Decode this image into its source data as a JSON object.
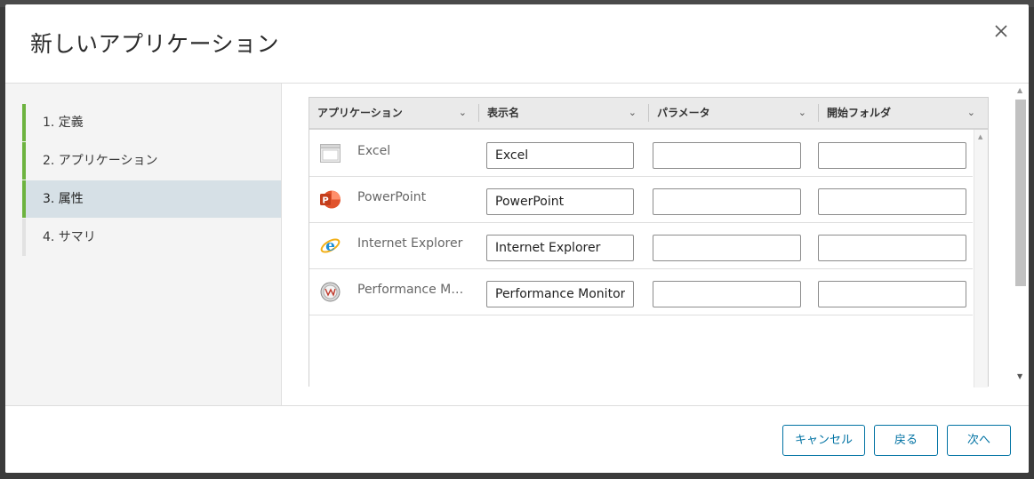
{
  "dialog": {
    "title": "新しいアプリケーション",
    "close_icon": "close-icon"
  },
  "steps": [
    {
      "label": "1. 定義",
      "state": "done"
    },
    {
      "label": "2. アプリケーション",
      "state": "done"
    },
    {
      "label": "3. 属性",
      "state": "active"
    },
    {
      "label": "4. サマリ",
      "state": "pending"
    }
  ],
  "grid": {
    "columns": [
      {
        "label": "アプリケーション"
      },
      {
        "label": "表示名"
      },
      {
        "label": "パラメータ"
      },
      {
        "label": "開始フォルダ"
      }
    ],
    "rows": [
      {
        "app": "Excel",
        "icon": "excel-icon",
        "display_name": "Excel",
        "parameters": "",
        "start_folder": ""
      },
      {
        "app": "PowerPoint",
        "icon": "powerpoint-icon",
        "display_name": "PowerPoint",
        "parameters": "",
        "start_folder": ""
      },
      {
        "app": "Internet Explorer",
        "icon": "internet-explorer-icon",
        "display_name": "Internet Explorer",
        "parameters": "",
        "start_folder": ""
      },
      {
        "app": "Performance Monitor",
        "icon": "performance-monitor-icon",
        "display_name": "Performance Monitor",
        "parameters": "",
        "start_folder": ""
      }
    ]
  },
  "footer": {
    "cancel_label": "キャンセル",
    "back_label": "戻る",
    "next_label": "次へ"
  },
  "colors": {
    "accent": "#0072a3",
    "step_progress": "#6db33f",
    "active_step_bg": "#d6e0e6"
  }
}
